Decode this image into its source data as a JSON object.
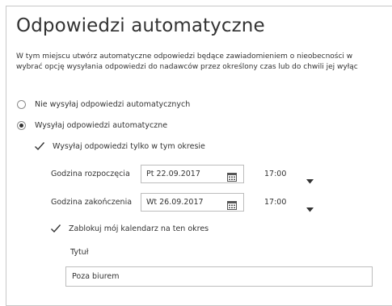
{
  "page": {
    "title": "Odpowiedzi automatyczne",
    "description_line1": "W tym miejscu utwórz automatyczne odpowiedzi będące zawiadomieniem o nieobecności w",
    "description_line2": "wybrać opcję wysyłania odpowiedzi do nadawców przez określony czas lub do chwili jej wyłąc"
  },
  "options": {
    "no_auto_replies": {
      "label": "Nie wysyłaj odpowiedzi automatycznych",
      "selected": false
    },
    "send_auto_replies": {
      "label": "Wysyłaj odpowiedzi automatyczne",
      "selected": true
    },
    "only_in_period": {
      "label": "Wysyłaj odpowiedzi tylko w tym okresie",
      "checked": true
    }
  },
  "schedule": {
    "start": {
      "label": "Godzina rozpoczęcia",
      "date": "Pt 22.09.2017",
      "time": "17:00"
    },
    "end": {
      "label": "Godzina zakończenia",
      "date": "Wt 26.09.2017",
      "time": "17:00"
    }
  },
  "block_calendar": {
    "label": "Zablokuj mój kalendarz na ten okres",
    "checked": true,
    "title_label": "Tytuł",
    "title_value": "Poza biurem"
  },
  "icons": {
    "calendar": "calendar-icon",
    "dropdown": "chevron-down-icon",
    "check": "checkmark-icon"
  },
  "colors": {
    "text": "#333333",
    "border": "#bdbdbd",
    "panel_border": "#c8c8c8"
  }
}
